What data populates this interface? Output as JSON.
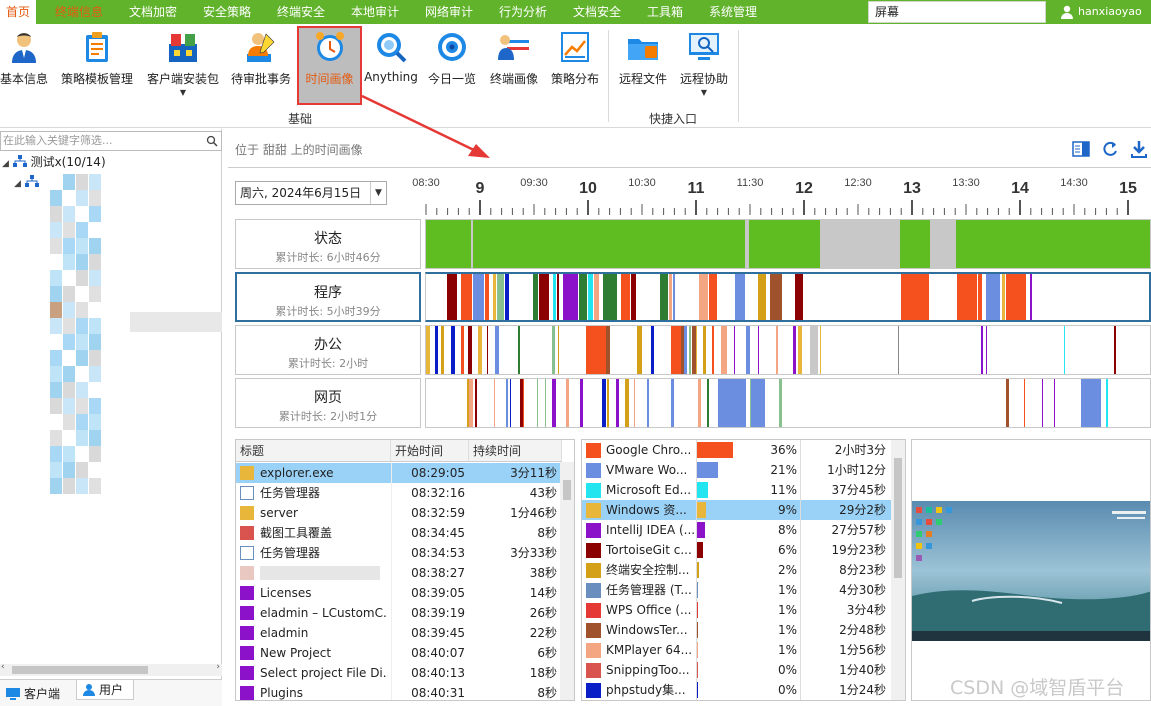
{
  "menu": [
    "首页",
    "终端信息",
    "文档加密",
    "安全策略",
    "终端安全",
    "本地审计",
    "网络审计",
    "行为分析",
    "文档安全",
    "工具箱",
    "系统管理"
  ],
  "menu_active": 1,
  "search_value": "屏幕",
  "username": "hanxiaoyao",
  "ribbon": {
    "buttons": [
      {
        "label": "基本信息",
        "icon": "user-info-icon"
      },
      {
        "label": "策略模板管理",
        "icon": "policy-template-icon"
      },
      {
        "label": "客户端安装包",
        "icon": "install-package-icon",
        "dropdown": true
      },
      {
        "label": "待审批事务",
        "icon": "approval-icon"
      },
      {
        "label": "时间画像",
        "icon": "alarm-clock-icon",
        "selected": true
      },
      {
        "label": "Anything",
        "icon": "search-globe-icon"
      },
      {
        "label": "今日一览",
        "icon": "eye-icon"
      },
      {
        "label": "终端画像",
        "icon": "terminal-profile-icon"
      },
      {
        "label": "策略分布",
        "icon": "chart-distribution-icon"
      },
      {
        "label": "远程文件",
        "icon": "remote-file-icon"
      },
      {
        "label": "远程协助",
        "icon": "remote-assist-icon",
        "dropdown": true
      }
    ],
    "groups": [
      "基础",
      "快捷入口"
    ]
  },
  "left": {
    "filter_placeholder": "在此输入关键字筛选...",
    "root_label": "测试x(10/14)",
    "tabs": [
      "客户端",
      "用户"
    ]
  },
  "main": {
    "breadcrumb": "位于 甜甜 上的时间画像",
    "date": "周六, 2024年6月15日",
    "ticks_major": [
      "9",
      "10",
      "11",
      "12",
      "13",
      "14",
      "15"
    ],
    "ticks_half": [
      "08:30",
      "09:30",
      "10:30",
      "11:30",
      "12:30",
      "13:30",
      "14:30"
    ],
    "lanes": [
      {
        "title": "状态",
        "sub": "累计时长: 6小时46分"
      },
      {
        "title": "程序",
        "sub": "累计时长: 5小时39分"
      },
      {
        "title": "办公",
        "sub": "累计时长: 2小时"
      },
      {
        "title": "网页",
        "sub": "累计时长: 2小时1分"
      }
    ]
  },
  "events_table": {
    "headers": [
      "标题",
      "开始时间",
      "持续时间"
    ],
    "rows": [
      {
        "title": "explorer.exe",
        "start": "08:29:05",
        "duration": "3分11秒",
        "icon": "folder-icon",
        "color": "#e8b63b"
      },
      {
        "title": "任务管理器",
        "start": "08:32:16",
        "duration": "43秒",
        "icon": "task-manager-icon",
        "color": "#6a8fbf"
      },
      {
        "title": "server",
        "start": "08:32:59",
        "duration": "1分46秒",
        "icon": "folder-icon",
        "color": "#e8b63b"
      },
      {
        "title": "截图工具覆盖",
        "start": "08:34:45",
        "duration": "8秒",
        "icon": "snipping-icon",
        "color": "#d9534f"
      },
      {
        "title": "任务管理器",
        "start": "08:34:53",
        "duration": "3分33秒",
        "icon": "task-manager-icon",
        "color": "#6a8fbf"
      },
      {
        "title": "",
        "start": "08:38:27",
        "duration": "38秒",
        "icon": "blank-icon",
        "color": "#e8c8c0"
      },
      {
        "title": "Licenses",
        "start": "08:39:05",
        "duration": "14秒",
        "icon": "purple-square-icon",
        "color": "#8b12c9"
      },
      {
        "title": "eladmin – LCustomC...",
        "start": "08:39:19",
        "duration": "26秒",
        "icon": "purple-square-icon",
        "color": "#8b12c9"
      },
      {
        "title": "eladmin",
        "start": "08:39:45",
        "duration": "22秒",
        "icon": "purple-square-icon",
        "color": "#8b12c9"
      },
      {
        "title": "New Project",
        "start": "08:40:07",
        "duration": "6秒",
        "icon": "purple-square-icon",
        "color": "#8b12c9"
      },
      {
        "title": "Select project File Di...",
        "start": "08:40:13",
        "duration": "18秒",
        "icon": "purple-square-icon",
        "color": "#8b12c9"
      },
      {
        "title": "Plugins",
        "start": "08:40:31",
        "duration": "8秒",
        "icon": "purple-square-icon",
        "color": "#8b12c9"
      }
    ]
  },
  "apps_table": {
    "rows": [
      {
        "name": "Google Chro...",
        "pct": "36%",
        "time": "2小时3分",
        "color": "#f4511e",
        "frac": 0.36
      },
      {
        "name": "VMware Wo...",
        "pct": "21%",
        "time": "1小时12分",
        "color": "#6c8ee0",
        "frac": 0.21
      },
      {
        "name": "Microsoft Ed...",
        "pct": "11%",
        "time": "37分45秒",
        "color": "#22e5f0",
        "frac": 0.11
      },
      {
        "name": "Windows 资...",
        "pct": "9%",
        "time": "29分2秒",
        "color": "#e8b63b",
        "frac": 0.09,
        "icon": "folder"
      },
      {
        "name": "IntelliJ IDEA (...",
        "pct": "8%",
        "time": "27分57秒",
        "color": "#8b12c9",
        "frac": 0.08
      },
      {
        "name": "TortoiseGit c...",
        "pct": "6%",
        "time": "19分23秒",
        "color": "#8b0000",
        "frac": 0.06
      },
      {
        "name": "终端安全控制...",
        "pct": "2%",
        "time": "8分23秒",
        "color": "#d4a017",
        "frac": 0.02
      },
      {
        "name": "任务管理器 (T...",
        "pct": "1%",
        "time": "4分30秒",
        "color": "#6a8fbf",
        "frac": 0.01,
        "icon": "task"
      },
      {
        "name": "WPS Office (...",
        "pct": "1%",
        "time": "3分4秒",
        "color": "#e53935",
        "frac": 0.01,
        "icon": "wps"
      },
      {
        "name": "WindowsTer...",
        "pct": "1%",
        "time": "2分48秒",
        "color": "#a0522d",
        "frac": 0.01
      },
      {
        "name": "KMPlayer 64...",
        "pct": "1%",
        "time": "1分56秒",
        "color": "#f4a582",
        "frac": 0.01
      },
      {
        "name": "SnippingToo...",
        "pct": "0%",
        "time": "1分40秒",
        "color": "#d9534f",
        "frac": 0.0,
        "icon": "snip"
      },
      {
        "name": "phpstudy集...",
        "pct": "0%",
        "time": "1分24秒",
        "color": "#0a1ec8",
        "frac": 0.0
      }
    ]
  },
  "watermark": "CSDN @域智盾平台",
  "colors": {
    "menubar": "#62b32c",
    "active_orange": "#e35a10",
    "lane_green": "#5fbd22",
    "idle_gray": "#c8c8c8"
  }
}
